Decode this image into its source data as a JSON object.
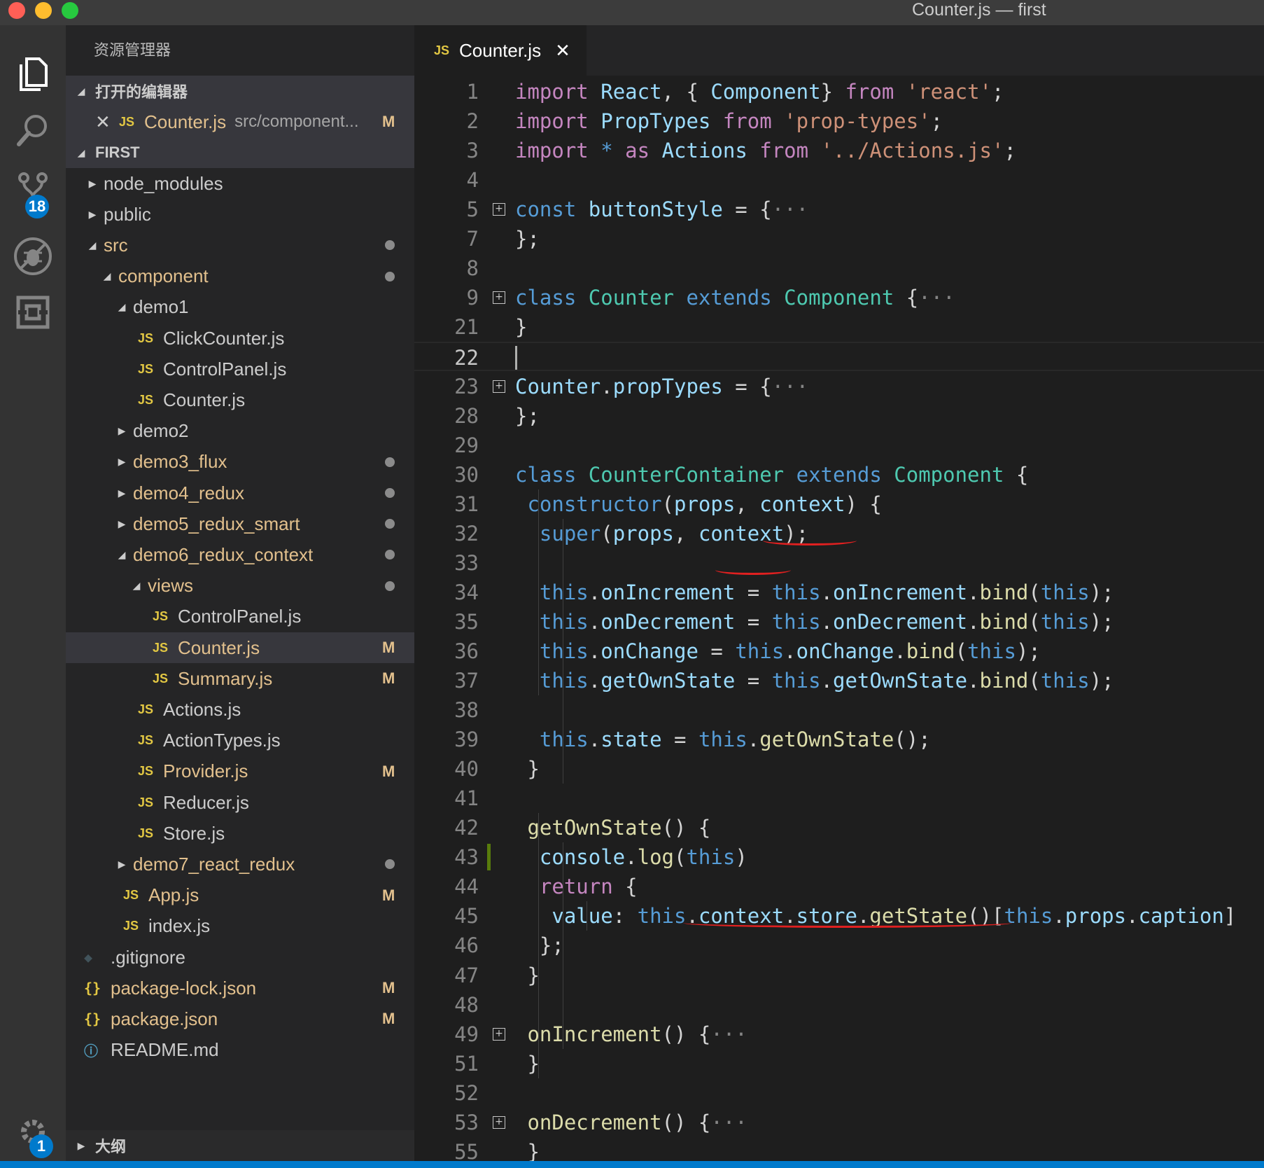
{
  "window": {
    "title": "Counter.js — first",
    "traffic_lights": [
      "#ff5f56",
      "#ffbd2e",
      "#27c93f"
    ]
  },
  "activity_bar": {
    "scm_badge": "18",
    "settings_badge": "1",
    "accent": "#007acc"
  },
  "sidebar": {
    "header": "资源管理器",
    "open_editors_title": "打开的编辑器",
    "open_editor": {
      "name": "Counter.js",
      "path": "src/component...",
      "status": "M"
    },
    "project_title": "FIRST",
    "outline_title": "大纲",
    "tree": [
      {
        "name": "node_modules",
        "kind": "folder-collapsed",
        "modified": false
      },
      {
        "name": "public",
        "kind": "folder-collapsed",
        "modified": false
      },
      {
        "name": "src",
        "kind": "folder-open",
        "modified": true
      },
      {
        "name": "component",
        "kind": "folder-open",
        "modified": true
      },
      {
        "name": "demo1",
        "kind": "folder-open",
        "modified": false
      },
      {
        "name": "ClickCounter.js",
        "kind": "js",
        "modified": false
      },
      {
        "name": "ControlPanel.js",
        "kind": "js",
        "modified": false
      },
      {
        "name": "Counter.js",
        "kind": "js",
        "modified": false
      },
      {
        "name": "demo2",
        "kind": "folder-collapsed",
        "modified": false
      },
      {
        "name": "demo3_flux",
        "kind": "folder-collapsed",
        "modified": true
      },
      {
        "name": "demo4_redux",
        "kind": "folder-collapsed",
        "modified": true
      },
      {
        "name": "demo5_redux_smart",
        "kind": "folder-collapsed",
        "modified": true
      },
      {
        "name": "demo6_redux_context",
        "kind": "folder-open",
        "modified": true
      },
      {
        "name": "views",
        "kind": "folder-open",
        "modified": true
      },
      {
        "name": "ControlPanel.js",
        "kind": "js",
        "modified": false
      },
      {
        "name": "Counter.js",
        "kind": "js",
        "modified": true,
        "status": "M",
        "selected": true
      },
      {
        "name": "Summary.js",
        "kind": "js",
        "modified": true,
        "status": "M"
      },
      {
        "name": "Actions.js",
        "kind": "js",
        "modified": false
      },
      {
        "name": "ActionTypes.js",
        "kind": "js",
        "modified": false
      },
      {
        "name": "Provider.js",
        "kind": "js",
        "modified": true,
        "status": "M"
      },
      {
        "name": "Reducer.js",
        "kind": "js",
        "modified": false
      },
      {
        "name": "Store.js",
        "kind": "js",
        "modified": false
      },
      {
        "name": "demo7_react_redux",
        "kind": "folder-collapsed",
        "modified": true
      },
      {
        "name": "App.js",
        "kind": "js",
        "modified": true,
        "status": "M"
      },
      {
        "name": "index.js",
        "kind": "js",
        "modified": false
      },
      {
        "name": ".gitignore",
        "kind": "git",
        "modified": false
      },
      {
        "name": "package-lock.json",
        "kind": "json",
        "modified": true,
        "status": "M"
      },
      {
        "name": "package.json",
        "kind": "json",
        "modified": true,
        "status": "M"
      },
      {
        "name": "README.md",
        "kind": "info",
        "modified": false
      }
    ]
  },
  "editor": {
    "tab": {
      "label": "Counter.js",
      "icon": "JS"
    },
    "lines": [
      {
        "n": "1",
        "fold": false,
        "tokens": [
          [
            "kw",
            "import"
          ],
          [
            "",
            "  "
          ],
          [
            "vr",
            "React"
          ],
          [
            "",
            ", { "
          ],
          [
            "vr",
            "Component"
          ],
          [
            "",
            "} "
          ],
          [
            "kw",
            "from"
          ],
          [
            "",
            "  "
          ],
          [
            "st",
            "'react'"
          ],
          [
            "",
            ";"
          ]
        ]
      },
      {
        "n": "2",
        "fold": false,
        "tokens": [
          [
            "kw",
            "import"
          ],
          [
            "",
            "  "
          ],
          [
            "vr",
            "PropTypes"
          ],
          [
            "",
            "  "
          ],
          [
            "kw",
            "from"
          ],
          [
            "",
            "  "
          ],
          [
            "st",
            "'prop-types'"
          ],
          [
            "",
            ";"
          ]
        ]
      },
      {
        "n": "3",
        "fold": false,
        "tokens": [
          [
            "kw",
            "import"
          ],
          [
            "",
            "  "
          ],
          [
            "bl",
            "*"
          ],
          [
            "",
            ""
          ],
          [
            "kw",
            " as"
          ],
          [
            "",
            "  "
          ],
          [
            "vr",
            "Actions"
          ],
          [
            "",
            "  "
          ],
          [
            "kw",
            "from"
          ],
          [
            "",
            "  "
          ],
          [
            "st",
            "'../Actions.js'"
          ],
          [
            "",
            ";"
          ]
        ]
      },
      {
        "n": "4",
        "fold": false,
        "tokens": []
      },
      {
        "n": "5",
        "fold": true,
        "tokens": [
          [
            "bl",
            "const"
          ],
          [
            "",
            "  "
          ],
          [
            "vr",
            "buttonStyle"
          ],
          [
            "",
            " = {"
          ],
          [
            "el",
            "···"
          ]
        ]
      },
      {
        "n": "7",
        "fold": false,
        "tokens": [
          [
            "",
            "};"
          ]
        ]
      },
      {
        "n": "8",
        "fold": false,
        "tokens": []
      },
      {
        "n": "9",
        "fold": true,
        "tokens": [
          [
            "bl",
            "class"
          ],
          [
            "",
            "  "
          ],
          [
            "ty",
            "Counter"
          ],
          [
            "",
            "  "
          ],
          [
            "bl",
            "extends"
          ],
          [
            "",
            "  "
          ],
          [
            "ty",
            "Component"
          ],
          [
            "",
            " {"
          ],
          [
            "el",
            "···"
          ]
        ]
      },
      {
        "n": "21",
        "fold": false,
        "tokens": [
          [
            "",
            "}"
          ]
        ]
      },
      {
        "n": "22",
        "fold": false,
        "active": true,
        "tokens": []
      },
      {
        "n": "23",
        "fold": true,
        "tokens": [
          [
            "vr",
            "Counter"
          ],
          [
            "",
            "."
          ],
          [
            "vr",
            "propTypes"
          ],
          [
            "",
            " = {"
          ],
          [
            "el",
            "···"
          ]
        ]
      },
      {
        "n": "28",
        "fold": false,
        "tokens": [
          [
            "",
            "};"
          ]
        ]
      },
      {
        "n": "29",
        "fold": false,
        "tokens": []
      },
      {
        "n": "30",
        "fold": false,
        "tokens": [
          [
            "bl",
            "class"
          ],
          [
            "",
            "  "
          ],
          [
            "ty",
            "CounterContainer"
          ],
          [
            "",
            "  "
          ],
          [
            "bl",
            "extends"
          ],
          [
            "",
            "  "
          ],
          [
            "ty",
            "Component"
          ],
          [
            "",
            " {"
          ]
        ]
      },
      {
        "n": "31",
        "fold": false,
        "tokens": [
          [
            "",
            "  "
          ],
          [
            "bl",
            "constructor"
          ],
          [
            "",
            "("
          ],
          [
            "vr",
            "props"
          ],
          [
            "",
            ", "
          ],
          [
            "vr",
            "context"
          ],
          [
            "",
            ") {"
          ]
        ]
      },
      {
        "n": "32",
        "fold": false,
        "tokens": [
          [
            "",
            "    "
          ],
          [
            "bl",
            "super"
          ],
          [
            "",
            "("
          ],
          [
            "vr",
            "props"
          ],
          [
            "",
            ", "
          ],
          [
            "vr",
            "context"
          ],
          [
            "",
            ");"
          ]
        ]
      },
      {
        "n": "33",
        "fold": false,
        "tokens": []
      },
      {
        "n": "34",
        "fold": false,
        "tokens": [
          [
            "",
            "    "
          ],
          [
            "bl",
            "this"
          ],
          [
            "",
            "."
          ],
          [
            "vr",
            "onIncrement"
          ],
          [
            "",
            " = "
          ],
          [
            "bl",
            "this"
          ],
          [
            "",
            "."
          ],
          [
            "vr",
            "onIncrement"
          ],
          [
            "",
            "."
          ],
          [
            "fn",
            "bind"
          ],
          [
            "",
            "("
          ],
          [
            "bl",
            "this"
          ],
          [
            "",
            ");"
          ]
        ]
      },
      {
        "n": "35",
        "fold": false,
        "tokens": [
          [
            "",
            "    "
          ],
          [
            "bl",
            "this"
          ],
          [
            "",
            "."
          ],
          [
            "vr",
            "onDecrement"
          ],
          [
            "",
            " = "
          ],
          [
            "bl",
            "this"
          ],
          [
            "",
            "."
          ],
          [
            "vr",
            "onDecrement"
          ],
          [
            "",
            "."
          ],
          [
            "fn",
            "bind"
          ],
          [
            "",
            "("
          ],
          [
            "bl",
            "this"
          ],
          [
            "",
            ");"
          ]
        ]
      },
      {
        "n": "36",
        "fold": false,
        "tokens": [
          [
            "",
            "    "
          ],
          [
            "bl",
            "this"
          ],
          [
            "",
            "."
          ],
          [
            "vr",
            "onChange"
          ],
          [
            "",
            " = "
          ],
          [
            "bl",
            "this"
          ],
          [
            "",
            "."
          ],
          [
            "vr",
            "onChange"
          ],
          [
            "",
            "."
          ],
          [
            "fn",
            "bind"
          ],
          [
            "",
            "("
          ],
          [
            "bl",
            "this"
          ],
          [
            "",
            ");"
          ]
        ]
      },
      {
        "n": "37",
        "fold": false,
        "tokens": [
          [
            "",
            "    "
          ],
          [
            "bl",
            "this"
          ],
          [
            "",
            "."
          ],
          [
            "vr",
            "getOwnState"
          ],
          [
            "",
            " = "
          ],
          [
            "bl",
            "this"
          ],
          [
            "",
            "."
          ],
          [
            "vr",
            "getOwnState"
          ],
          [
            "",
            "."
          ],
          [
            "fn",
            "bind"
          ],
          [
            "",
            "("
          ],
          [
            "bl",
            "this"
          ],
          [
            "",
            ");"
          ]
        ]
      },
      {
        "n": "38",
        "fold": false,
        "tokens": []
      },
      {
        "n": "39",
        "fold": false,
        "tokens": [
          [
            "",
            "    "
          ],
          [
            "bl",
            "this"
          ],
          [
            "",
            "."
          ],
          [
            "vr",
            "state"
          ],
          [
            "",
            " = "
          ],
          [
            "bl",
            "this"
          ],
          [
            "",
            "."
          ],
          [
            "fn",
            "getOwnState"
          ],
          [
            "",
            "();"
          ]
        ]
      },
      {
        "n": "40",
        "fold": false,
        "tokens": [
          [
            "",
            "  }"
          ]
        ]
      },
      {
        "n": "41",
        "fold": false,
        "tokens": []
      },
      {
        "n": "42",
        "fold": false,
        "tokens": [
          [
            "",
            "  "
          ],
          [
            "fn",
            "getOwnState"
          ],
          [
            "",
            "() {"
          ]
        ]
      },
      {
        "n": "43",
        "fold": false,
        "tokens": [
          [
            "",
            "    "
          ],
          [
            "vr",
            "console"
          ],
          [
            "",
            "."
          ],
          [
            "fn",
            "log"
          ],
          [
            "",
            "("
          ],
          [
            "bl",
            "this"
          ],
          [
            "",
            ")"
          ]
        ]
      },
      {
        "n": "44",
        "fold": false,
        "tokens": [
          [
            "",
            "    "
          ],
          [
            "kw",
            "return"
          ],
          [
            "",
            " {"
          ]
        ]
      },
      {
        "n": "45",
        "fold": false,
        "tokens": [
          [
            "",
            "      "
          ],
          [
            "vr",
            "value"
          ],
          [
            "",
            ": "
          ],
          [
            "bl",
            "this"
          ],
          [
            "",
            "."
          ],
          [
            "vr",
            "context"
          ],
          [
            "",
            "."
          ],
          [
            "vr",
            "store"
          ],
          [
            "",
            "."
          ],
          [
            "fn",
            "getState"
          ],
          [
            "",
            "()["
          ],
          [
            "bl",
            "this"
          ],
          [
            "",
            "."
          ],
          [
            "vr",
            "props"
          ],
          [
            "",
            "."
          ],
          [
            "vr",
            "caption"
          ],
          [
            "",
            "]"
          ]
        ]
      },
      {
        "n": "46",
        "fold": false,
        "tokens": [
          [
            "",
            "    };"
          ]
        ]
      },
      {
        "n": "47",
        "fold": false,
        "tokens": [
          [
            "",
            "  }"
          ]
        ]
      },
      {
        "n": "48",
        "fold": false,
        "tokens": []
      },
      {
        "n": "49",
        "fold": true,
        "tokens": [
          [
            "",
            "  "
          ],
          [
            "fn",
            "onIncrement"
          ],
          [
            "",
            "() {"
          ],
          [
            "el",
            "···"
          ]
        ]
      },
      {
        "n": "51",
        "fold": false,
        "tokens": [
          [
            "",
            "  }"
          ]
        ]
      },
      {
        "n": "52",
        "fold": false,
        "tokens": []
      },
      {
        "n": "53",
        "fold": true,
        "tokens": [
          [
            "",
            "  "
          ],
          [
            "fn",
            "onDecrement"
          ],
          [
            "",
            "() {"
          ],
          [
            "el",
            "···"
          ]
        ]
      },
      {
        "n": "55",
        "fold": false,
        "tokens": [
          [
            "",
            "  }"
          ]
        ]
      }
    ]
  }
}
